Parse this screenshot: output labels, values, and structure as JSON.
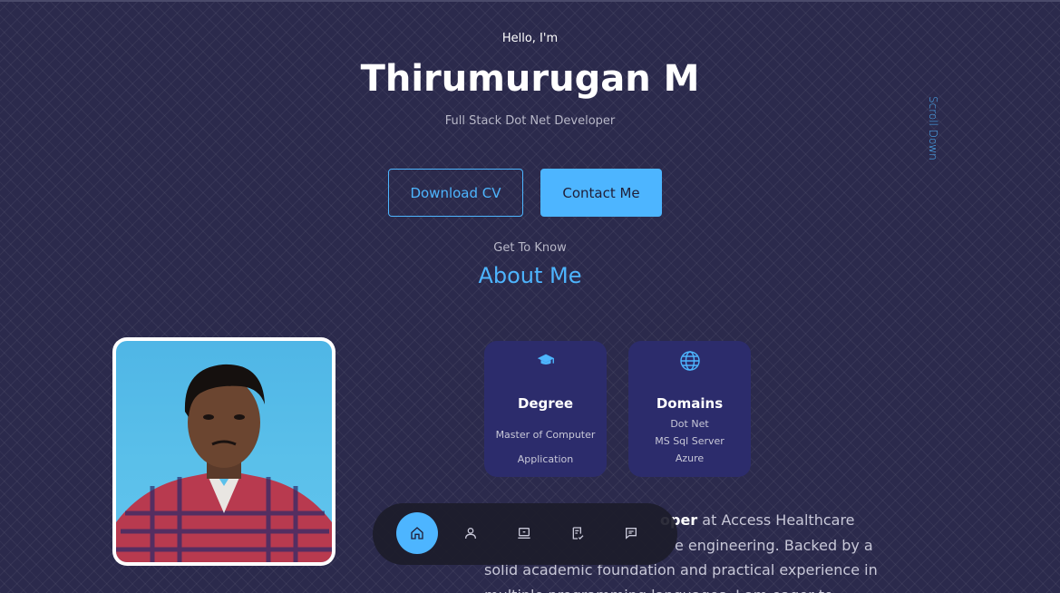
{
  "hero": {
    "greeting": "Hello, I'm",
    "name": "Thirumurugan M",
    "role": "Full Stack Dot Net Developer",
    "download_cv_label": "Download CV",
    "contact_label": "Contact Me",
    "scroll_label": "Scroll Down"
  },
  "about": {
    "subtitle": "Get To Know",
    "title": "About Me",
    "cards": {
      "degree": {
        "icon": "graduation-cap-icon",
        "title": "Degree",
        "line1": "Master of Computer",
        "line2": "Application"
      },
      "domains": {
        "icon": "globe-icon",
        "title": "Domains",
        "items": [
          "Dot Net",
          "MS Sql Server",
          "Azure"
        ]
      }
    },
    "paragraph": {
      "bold": "oper",
      "line1_rest": " at Access Healthcare",
      "line2": "e engineering. Backed by a",
      "line3": "solid academic foundation and practical experience in",
      "line4": "multiple programming languages, I am eager to"
    }
  },
  "nav": {
    "items": [
      {
        "icon": "home-icon",
        "active": true
      },
      {
        "icon": "user-icon",
        "active": false
      },
      {
        "icon": "laptop-icon",
        "active": false
      },
      {
        "icon": "notes-icon",
        "active": false
      },
      {
        "icon": "message-icon",
        "active": false
      }
    ]
  },
  "colors": {
    "background": "#2b2a4c",
    "accent": "#4db5ff",
    "card": "#2c2c6c",
    "nav": "#1c1c2a"
  }
}
